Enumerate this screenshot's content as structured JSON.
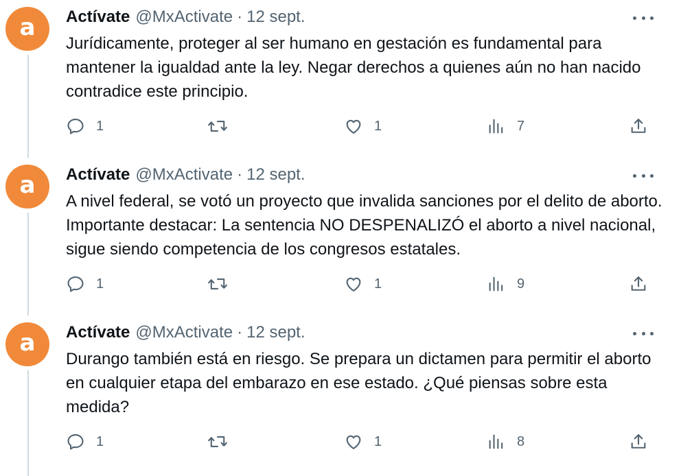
{
  "tweets": [
    {
      "author_name": "Actívate",
      "handle": "@MxActivate",
      "separator": "·",
      "date": "12 sept.",
      "avatar_letter": "a",
      "text": "Jurídicamente, proteger al ser humano en gestación es fundamental para mantener la igualdad ante la ley. Negar derechos a quienes aún no han nacido contradice este principio.",
      "replies": "1",
      "retweets": "",
      "likes": "1",
      "views": "7"
    },
    {
      "author_name": "Actívate",
      "handle": "@MxActivate",
      "separator": "·",
      "date": "12 sept.",
      "avatar_letter": "a",
      "text": "A nivel federal, se votó un proyecto que invalida sanciones por el delito de aborto. Importante destacar: La sentencia NO DESPENALIZÓ el aborto a nivel nacional, sigue siendo competencia de los congresos estatales.",
      "replies": "1",
      "retweets": "",
      "likes": "1",
      "views": "9"
    },
    {
      "author_name": "Actívate",
      "handle": "@MxActivate",
      "separator": "·",
      "date": "12 sept.",
      "avatar_letter": "a",
      "text": "Durango también está en riesgo. Se prepara un dictamen para permitir el aborto en cualquier etapa del embarazo en ese estado. ¿Qué piensas sobre esta medida?",
      "replies": "1",
      "retweets": "",
      "likes": "1",
      "views": "8"
    }
  ],
  "icons": {
    "avatar": "avatar-letter",
    "more": "more-icon",
    "reply": "reply-icon",
    "retweet": "retweet-icon",
    "like": "like-icon",
    "views": "views-icon",
    "share": "share-icon"
  },
  "colors": {
    "avatar_bg": "#f08a3a",
    "text_primary": "#0f1419",
    "text_secondary": "#536471",
    "thread_line": "#cfd9de"
  }
}
